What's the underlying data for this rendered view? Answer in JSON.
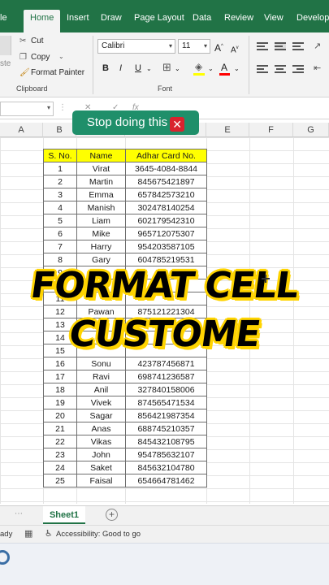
{
  "ribbon_tabs": [
    "le",
    "Home",
    "Insert",
    "Draw",
    "Page Layout",
    "Data",
    "Review",
    "View",
    "Develope"
  ],
  "clipboard": {
    "paste_fragment": "ste",
    "cut": "Cut",
    "copy": "Copy",
    "format_painter": "Format Painter",
    "group_label": "Clipboard"
  },
  "font": {
    "family": "Calibri",
    "size": "11",
    "bold": "B",
    "italic": "I",
    "underline": "U",
    "grow": "A",
    "shrink": "A",
    "group_label": "Font",
    "fill_color": "#ffff00",
    "text_color": "#ff0000"
  },
  "formula_bar": {
    "fx": "fx",
    "cancel": "✕",
    "enter": "✓"
  },
  "columns": [
    "A",
    "B",
    "C",
    "D",
    "E",
    "F",
    "G"
  ],
  "banner": {
    "text": "Stop doing this",
    "mark": "✕"
  },
  "table": {
    "headers": [
      "S. No.",
      "Name",
      "Adhar Card No."
    ],
    "rows": [
      [
        "1",
        "Virat",
        "3645-4084-8844"
      ],
      [
        "2",
        "Martin",
        "845675421897"
      ],
      [
        "3",
        "Emma",
        "657842573210"
      ],
      [
        "4",
        "Manish",
        "302478140254"
      ],
      [
        "5",
        "Liam",
        "602179542310"
      ],
      [
        "6",
        "Mike",
        "965712075307"
      ],
      [
        "7",
        "Harry",
        "954203587105"
      ],
      [
        "8",
        "Gary",
        "604785219531"
      ],
      [
        "9",
        "",
        ""
      ],
      [
        "10",
        "",
        ""
      ],
      [
        "11",
        "",
        ""
      ],
      [
        "12",
        "Pawan",
        "875121221304"
      ],
      [
        "13",
        "",
        ""
      ],
      [
        "14",
        "",
        ""
      ],
      [
        "15",
        "",
        ""
      ],
      [
        "16",
        "Sonu",
        "423787456871"
      ],
      [
        "17",
        "Ravi",
        "698741236587"
      ],
      [
        "18",
        "Anil",
        "327840158006"
      ],
      [
        "19",
        "Vivek",
        "874565471534"
      ],
      [
        "20",
        "Sagar",
        "856421987354"
      ],
      [
        "21",
        "Anas",
        "688745210357"
      ],
      [
        "22",
        "Vikas",
        "845432108795"
      ],
      [
        "23",
        "John",
        "954785632107"
      ],
      [
        "24",
        "Saket",
        "845632104780"
      ],
      [
        "25",
        "Faisal",
        "654664781462"
      ]
    ]
  },
  "overlay": {
    "line1": "FORMAT CELL",
    "line2": "CUSTOME"
  },
  "sheet_tab": "Sheet1",
  "add_sheet": "+",
  "status": {
    "ready_fragment": "ady",
    "accessibility": "Accessibility: Good to go"
  }
}
